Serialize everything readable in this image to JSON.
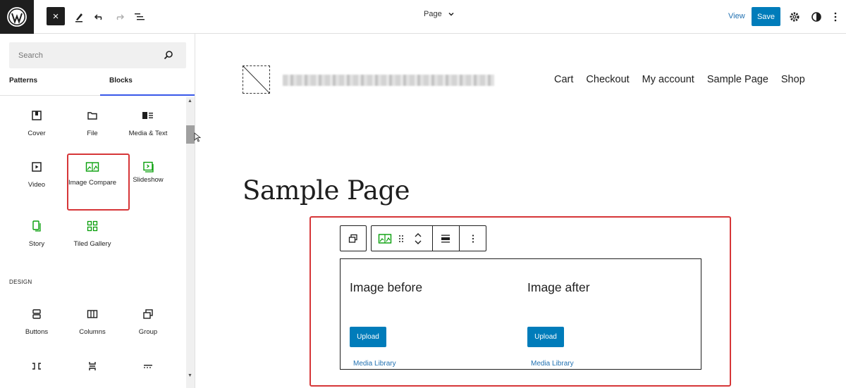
{
  "topbar": {
    "close_icon": "×",
    "document_title": "Page",
    "view_label": "View",
    "save_label": "Save"
  },
  "sidebar": {
    "search_placeholder": "Search",
    "tabs": [
      {
        "label": "Patterns",
        "active": false
      },
      {
        "label": "Blocks",
        "active": true
      }
    ],
    "blocks": [
      {
        "label": "Cover",
        "icon": "cover-icon"
      },
      {
        "label": "File",
        "icon": "folder-icon"
      },
      {
        "label": "Media & Text",
        "icon": "media-text-icon"
      },
      {
        "label": "Video",
        "icon": "video-icon"
      },
      {
        "label": "Image Compare",
        "icon": "image-compare-icon",
        "highlighted": true
      },
      {
        "label": "Slideshow",
        "icon": "slideshow-icon"
      },
      {
        "label": "Story",
        "icon": "story-icon"
      },
      {
        "label": "Tiled Gallery",
        "icon": "tiled-gallery-icon"
      }
    ],
    "design_section_label": "DESIGN",
    "design_blocks": [
      {
        "label": "Buttons",
        "icon": "buttons-icon"
      },
      {
        "label": "Columns",
        "icon": "columns-icon"
      },
      {
        "label": "Group",
        "icon": "group-icon"
      }
    ]
  },
  "canvas": {
    "nav": [
      "Cart",
      "Checkout",
      "My account",
      "Sample Page",
      "Shop"
    ],
    "page_title": "Sample Page",
    "image_compare": {
      "before_label": "Image before",
      "after_label": "Image after",
      "upload_label": "Upload",
      "media_library_label": "Media Library"
    }
  },
  "colors": {
    "accent": "#007cba",
    "highlight": "#d63638",
    "jetpack_green": "#069e08",
    "dark": "#1e1e1e"
  }
}
